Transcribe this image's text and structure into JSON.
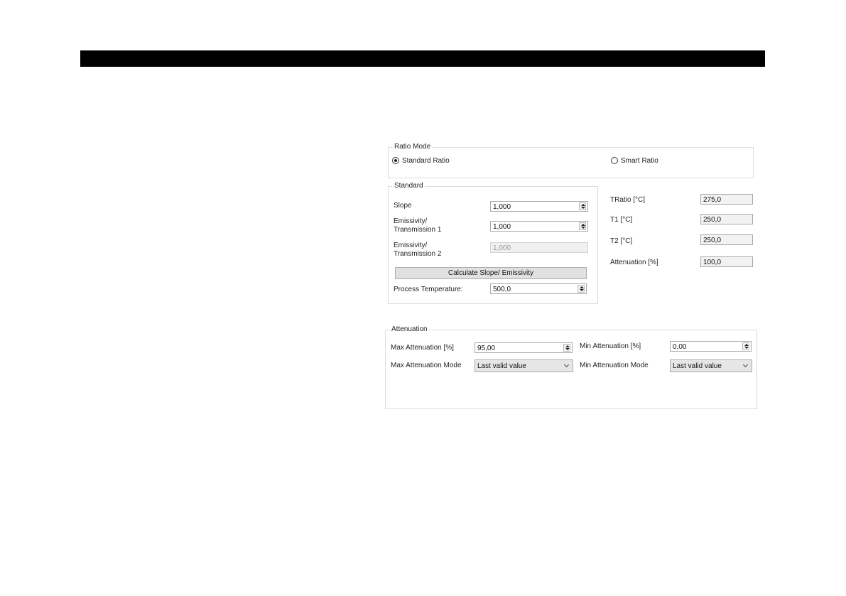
{
  "ratio_mode": {
    "title": "Ratio Mode",
    "options": [
      {
        "label": "Standard Ratio",
        "selected": true
      },
      {
        "label": "Smart Ratio",
        "selected": false
      }
    ]
  },
  "standard": {
    "title": "Standard",
    "slope_label": "Slope",
    "slope_value": "1,000",
    "emissivity1_label_line1": "Emissivity/",
    "emissivity1_label_line2": "Transmission 1",
    "emissivity1_value": "1,000",
    "emissivity2_label_line1": "Emissivity/",
    "emissivity2_label_line2": "Transmission 2",
    "emissivity2_value": "1,000",
    "calculate_button": "Calculate Slope/ Emissivity",
    "process_temp_label": "Process Temperature:",
    "process_temp_value": "500,0"
  },
  "readouts": {
    "tratio_label": "TRatio [°C]",
    "tratio_value": "275,0",
    "t1_label": "T1 [°C]",
    "t1_value": "250,0",
    "t2_label": "T2 [°C]",
    "t2_value": "250,0",
    "attenuation_label": "Attenuation [%]",
    "attenuation_value": "100,0"
  },
  "attenuation": {
    "title": "Attenuation",
    "max_label": "Max Attenuation [%]",
    "max_value": "95,00",
    "min_label": "Min Attenuation [%]",
    "min_value": "0,00",
    "max_mode_label": "Max Attenuation Mode",
    "max_mode_value": "Last valid value",
    "min_mode_label": "Min Attenuation Mode",
    "min_mode_value": "Last valid value"
  }
}
